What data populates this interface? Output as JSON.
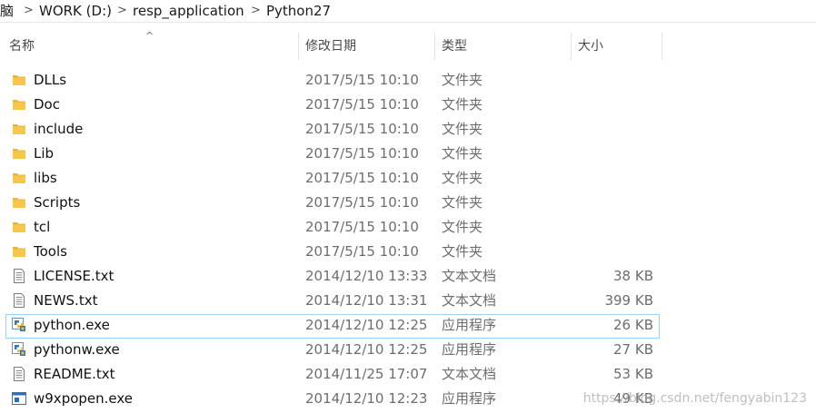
{
  "breadcrumb": {
    "items": [
      "脑",
      "WORK (D:)",
      "resp_application",
      "Python27"
    ],
    "separator": ">"
  },
  "columns": {
    "name": "名称",
    "date": "修改日期",
    "type": "类型",
    "size": "大小",
    "sort_indicator": "^"
  },
  "files": [
    {
      "name": "DLLs",
      "date": "2017/5/15 10:10",
      "type": "文件夹",
      "size": "",
      "icon": "folder-icon"
    },
    {
      "name": "Doc",
      "date": "2017/5/15 10:10",
      "type": "文件夹",
      "size": "",
      "icon": "folder-icon"
    },
    {
      "name": "include",
      "date": "2017/5/15 10:10",
      "type": "文件夹",
      "size": "",
      "icon": "folder-icon"
    },
    {
      "name": "Lib",
      "date": "2017/5/15 10:10",
      "type": "文件夹",
      "size": "",
      "icon": "folder-icon"
    },
    {
      "name": "libs",
      "date": "2017/5/15 10:10",
      "type": "文件夹",
      "size": "",
      "icon": "folder-icon"
    },
    {
      "name": "Scripts",
      "date": "2017/5/15 10:10",
      "type": "文件夹",
      "size": "",
      "icon": "folder-icon"
    },
    {
      "name": "tcl",
      "date": "2017/5/15 10:10",
      "type": "文件夹",
      "size": "",
      "icon": "folder-icon"
    },
    {
      "name": "Tools",
      "date": "2017/5/15 10:10",
      "type": "文件夹",
      "size": "",
      "icon": "folder-icon"
    },
    {
      "name": "LICENSE.txt",
      "date": "2014/12/10 13:33",
      "type": "文本文档",
      "size": "38 KB",
      "icon": "text-file-icon"
    },
    {
      "name": "NEWS.txt",
      "date": "2014/12/10 13:31",
      "type": "文本文档",
      "size": "399 KB",
      "icon": "text-file-icon"
    },
    {
      "name": "python.exe",
      "date": "2014/12/10 12:25",
      "type": "应用程序",
      "size": "26 KB",
      "icon": "python-icon",
      "selected": true
    },
    {
      "name": "pythonw.exe",
      "date": "2014/12/10 12:25",
      "type": "应用程序",
      "size": "27 KB",
      "icon": "python-icon"
    },
    {
      "name": "README.txt",
      "date": "2014/11/25 17:07",
      "type": "文本文档",
      "size": "53 KB",
      "icon": "text-file-icon"
    },
    {
      "name": "w9xpopen.exe",
      "date": "2014/12/10 12:23",
      "type": "应用程序",
      "size": "49 KB",
      "icon": "app-window-icon"
    }
  ],
  "colors": {
    "folder": "#e8b63c",
    "selection_border": "#99d1ff"
  },
  "watermark": "https://blog.csdn.net/fengyabin123"
}
